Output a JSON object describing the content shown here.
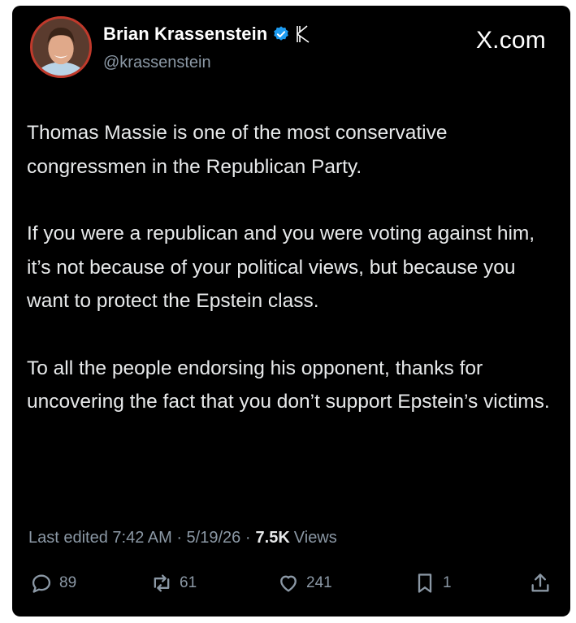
{
  "author": {
    "display_name": "Brian Krassenstein",
    "handle": "@krassenstein"
  },
  "site_label": "X.com",
  "tweet": {
    "paragraphs": [
      "Thomas Massie is one of the most conservative congressmen in the Republican Party.",
      "If you were a republican and you were voting against him, it’s not because of your political views, but because you want to protect the Epstein class.",
      "To all the people endorsing his opponent, thanks for uncovering the fact that you don’t support Epstein’s victims."
    ]
  },
  "meta": {
    "edited_text": "Last edited 7:42 AM · 5/19/26 ·",
    "views_count": "7.5K",
    "views_label": "Views"
  },
  "actions": {
    "replies": "89",
    "reposts": "61",
    "likes": "241",
    "bookmarks": "1"
  },
  "colors": {
    "background": "#000000",
    "text": "#e7e9ea",
    "secondary_text": "#8b98a5",
    "verified_badge": "#1d9bf0"
  }
}
